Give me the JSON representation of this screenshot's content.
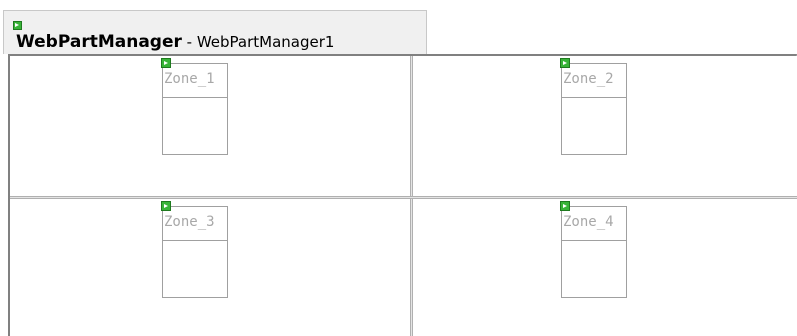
{
  "web_part_manager": {
    "type_name": "WebPartManager",
    "separator": " - ",
    "instance_id": "WebPartManager1",
    "glyph_icon": "smart-tag-icon"
  },
  "zones": [
    {
      "title": "Zone_1",
      "glyph_icon": "smart-tag-icon"
    },
    {
      "title": "Zone_2",
      "glyph_icon": "smart-tag-icon"
    },
    {
      "title": "Zone_3",
      "glyph_icon": "smart-tag-icon"
    },
    {
      "title": "Zone_4",
      "glyph_icon": "smart-tag-icon"
    }
  ],
  "colors": {
    "glyph_green": "#38b438",
    "zone_text": "#a8a8a8",
    "grid_border": "#808080"
  }
}
